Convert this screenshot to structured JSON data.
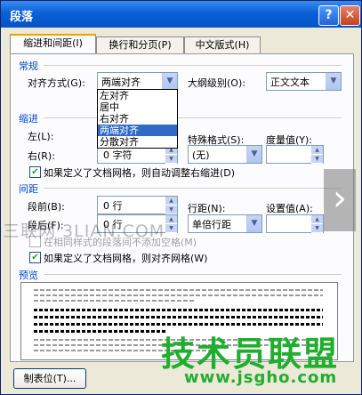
{
  "window": {
    "title": "段落",
    "help_icon": "?",
    "close_icon": "✕"
  },
  "tabs": [
    "缩进和间距(I)",
    "换行和分页(P)",
    "中文版式(H)"
  ],
  "general": {
    "section": "常规",
    "alignment_label": "对齐方式(G):",
    "alignment_value": "两端对齐",
    "alignment_options": [
      "左对齐",
      "居中",
      "右对齐",
      "两端对齐",
      "分散对齐"
    ],
    "alignment_selected_index": 3,
    "outline_label": "大纲级别(O):",
    "outline_value": "正文文本"
  },
  "indent": {
    "section": "缩进",
    "left_label": "左(L):",
    "right_label": "右(R):",
    "right_value": "0 字符",
    "special_label": "特殊格式(S):",
    "special_value": "(无)",
    "measure_label": "度量值(Y):",
    "auto_adjust_label": "如果定义了文档网格，则自动调整右缩进(D)",
    "auto_adjust_checked": true
  },
  "spacing": {
    "section": "间距",
    "before_label": "段前(B):",
    "before_value": "0 行",
    "after_label": "段后(F):",
    "after_value": "0 行",
    "line_label": "行距(N):",
    "line_value": "单倍行距",
    "setting_label": "设置值(A):",
    "no_space_label": "在相同样式的段落间不添加空格(M)",
    "no_space_checked": false,
    "snap_grid_label": "如果定义了文档网格，则对齐网格(W)",
    "snap_grid_checked": true
  },
  "preview": {
    "section": "预览"
  },
  "buttons": {
    "tabs_button": "制表位(T)..."
  },
  "watermarks": {
    "left": "三联网 3LIAN.COM",
    "brand": "技术员联盟",
    "url": "www.jsgho.com"
  },
  "colors": {
    "title_bar": "#0553c6",
    "selection": "#316ac5",
    "section": "#0046d5",
    "brand": "#1fae2e"
  }
}
